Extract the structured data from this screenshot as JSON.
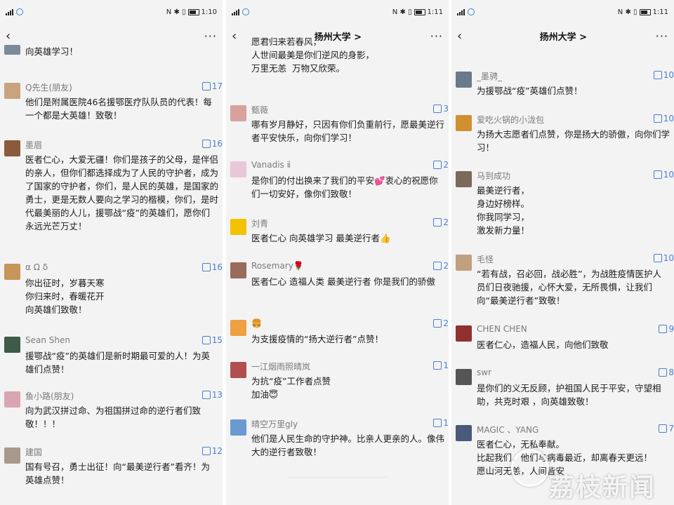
{
  "panels": [
    {
      "status": {
        "time": "1:10"
      },
      "nav": {
        "title": "",
        "more": "···"
      },
      "comments": [
        {
          "name": "",
          "text": "向英雄学习！",
          "avatar": "#7a8a9a"
        },
        {
          "name": "Q先生(朋友)",
          "likes": "17",
          "text": "他们是附属医院46名援鄂医疗队队员的代表！每一个都是大英雄！致敬！",
          "avatar": "#c9a27e"
        },
        {
          "name": "墨眉",
          "likes": "16",
          "text": "医者仁心，大爱无疆！你们是孩子的父母，是伴侣的亲人，但你们都选择成为了人民的守护者，成为了国家的守护者，你们，是人民的英雄，是国家的勇士，更是无数人要向之学习的楷模，你们，是时代最美丽的人儿，援鄂战“疫”的英雄们，愿你们永远光芒万丈！",
          "avatar": "#8a5a3a"
        },
        {
          "name": "α Ω δ",
          "likes": "16",
          "text": "你出征时，岁暮天寒\n你归来时，春暖花开\n向英雄们致敬！",
          "avatar": "#c7955a"
        },
        {
          "name": "Sean Shen",
          "likes": "15",
          "text": "援鄂战“疫”的英雄们是新时期最可爱的人！为英雄们点赞！",
          "avatar": "#3e5a4a"
        },
        {
          "name": "鱼小路(朋友)",
          "likes": "13",
          "text": "向为武汉拼过命、为祖国拼过命的逆行者们致敬！！！",
          "avatar": "#d9a5b0"
        },
        {
          "name": "建国",
          "likes": "12",
          "text": "国有号召，勇士出征！向“最美逆行者”看齐！为英雄点赞！",
          "avatar": "#a89a8a"
        }
      ]
    },
    {
      "status": {
        "time": "1:11"
      },
      "nav": {
        "title": "扬州大学 >",
        "more": "···"
      },
      "comments": [
        {
          "name": "",
          "text": "愿君归来若春风，\n人世间最美是你们逆风的身影，\n万里无恙  万物又欣荣。"
        },
        {
          "name": "甄薇",
          "likes": "3",
          "text": "哪有岁月静好，只因有你们负重前行，愿最美逆行者平安快乐，向你们学习！",
          "avatar": "#d9a0a0"
        },
        {
          "name": "Vanadis ⅱ",
          "likes": "2",
          "text": "是你们的付出换来了我们的平安💕衷心的祝愿你们一切安好，像你们致敬！",
          "avatar": "#e8c8d8"
        },
        {
          "name": "刘青",
          "likes": "2",
          "text": "医者仁心 向英雄学习 最美逆行者👍",
          "avatar": "#f2c200"
        },
        {
          "name": "Rosemary🌹",
          "likes": "2",
          "text": "医者仁心 造福人类 最美逆行者 你是我们的骄傲",
          "avatar": "#9a6a5a"
        },
        {
          "name": "🍔",
          "likes": "2",
          "text": "为支援疫情的“扬大逆行者”点赞！",
          "avatar": "#f0a040"
        },
        {
          "name": "一江烟雨照晴岚",
          "likes": "1",
          "text": "为抗“疫”工作者点赞\n加油😇",
          "avatar": "#b05050"
        },
        {
          "name": "晴空万里gly",
          "likes": "1",
          "text": "他们是人民生命的守护神。比亲人更亲的人。像伟大的逆行者致敬！",
          "avatar": "#6a9ad0"
        }
      ]
    },
    {
      "status": {
        "time": "1:11"
      },
      "nav": {
        "title": "扬州大学 >",
        "more": "···"
      },
      "comments": [
        {
          "name": "_墨骋_",
          "likes": "10",
          "text": "为援鄂战“疫”英雄们点赞！",
          "avatar": "#6a7a8a"
        },
        {
          "name": "爱吃火锅的小泷包",
          "likes": "10",
          "text": "为扬大志愿者们点赞，你是扬大的骄傲，向你们学习！",
          "avatar": "#d09030"
        },
        {
          "name": "马到成功",
          "likes": "10",
          "text": "最美逆行者，\n身边好榜样。\n你我同学习，\n激发新力量！",
          "avatar": "#7a6a5a"
        },
        {
          "name": "毛怪",
          "likes": "10",
          "text": "“若有战，召必回，战必胜”，为战胜疫情医护人员们日夜驰援，心怀大爱，无所畏惧，让我们向“最美逆行者”致敬！",
          "avatar": "#c0a080"
        },
        {
          "name": "CHEN CHEN",
          "likes": "9",
          "text": "医者仁心，造福人民，向他们致敬",
          "avatar": "#903030"
        },
        {
          "name": "swr",
          "likes": "8",
          "text": "是你们的义无反顾，护祖国人民于平安，守望相助，共克时艰 ，向英雄致敬！",
          "avatar": "#555555"
        },
        {
          "name": "MAGIC 、YANG",
          "likes": "7",
          "text": "医者仁心，无私奉献。\n比起我们，他们与病毒最近，却离春天更远！\n愿山河无恙，人间皆安",
          "avatar": "#4a5a7a"
        }
      ]
    }
  ],
  "watermark": "荔枝新闻",
  "icons": {
    "back": "chevron-left-icon",
    "more": "more-dots-icon",
    "like": "thumbs-up-icon"
  }
}
